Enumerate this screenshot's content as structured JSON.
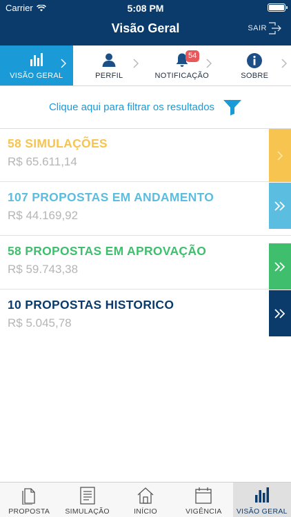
{
  "status_bar": {
    "carrier": "Carrier",
    "time": "5:08 PM"
  },
  "nav": {
    "title": "Visão Geral",
    "logout_label": "SAIR"
  },
  "top_tabs": [
    {
      "label": "VISÃO GERAL",
      "icon": "bar-chart-icon",
      "active": true
    },
    {
      "label": "PERFIL",
      "icon": "person-icon",
      "active": false
    },
    {
      "label": "NOTIFICAÇÃO",
      "icon": "bell-icon",
      "badge": "54",
      "active": false
    },
    {
      "label": "SOBRE",
      "icon": "info-icon",
      "active": false
    }
  ],
  "filter": {
    "text": "Clique aqui para filtrar os resultados",
    "icon": "filter-icon"
  },
  "results": [
    {
      "title": "58 SIMULAÇÕES",
      "value": "R$ 65.611,14",
      "color": "#f7c44f"
    },
    {
      "title": "107 PROPOSTAS EM ANDAMENTO",
      "value": "R$ 44.169,92",
      "color": "#5bbde0"
    },
    {
      "title": "58 PROPOSTAS EM APROVAÇÃO",
      "value": "R$ 59.743,38",
      "color": "#3fbf6e"
    },
    {
      "title": "10 PROPOSTAS HISTORICO",
      "value": "R$ 5.045,78",
      "color": "#0b3b6a"
    }
  ],
  "bottom_tabs": [
    {
      "label": "PROPOSTA",
      "icon": "document-icon",
      "active": false
    },
    {
      "label": "SIMULAÇÃO",
      "icon": "list-document-icon",
      "active": false
    },
    {
      "label": "INÍCIO",
      "icon": "home-icon",
      "active": false
    },
    {
      "label": "VIGÊNCIA",
      "icon": "calendar-icon",
      "active": false
    },
    {
      "label": "VISÃO GERAL",
      "icon": "bar-chart-icon",
      "active": true
    }
  ],
  "colors": {
    "header": "#0b3b6a",
    "accent": "#1a9ad6",
    "badge": "#e8575a"
  }
}
